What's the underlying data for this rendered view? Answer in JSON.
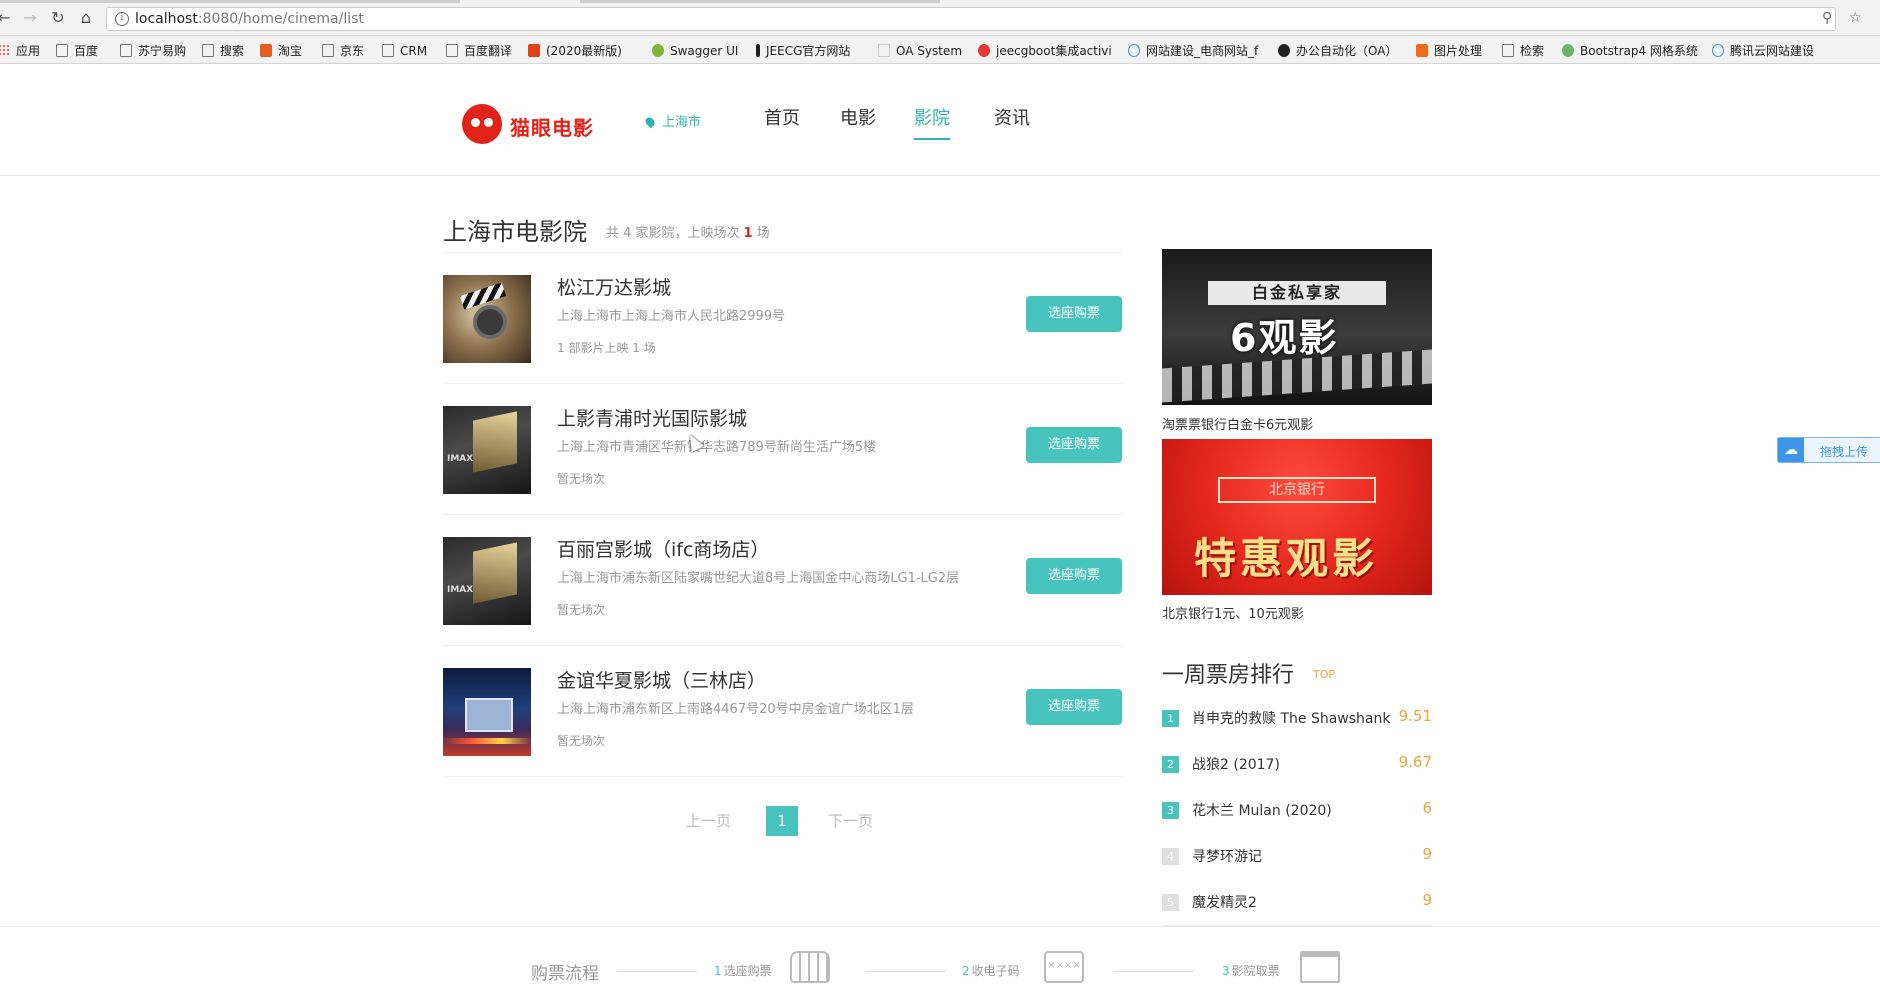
{
  "browser": {
    "url_host": "localhost",
    "url_path": ":8080/home/cinema/list",
    "bookmarks": [
      {
        "label": "应用",
        "icon": "apps-grid-icon"
      },
      {
        "label": "百度",
        "icon": "page-icon"
      },
      {
        "label": "苏宁易购",
        "icon": "page-icon"
      },
      {
        "label": "搜索",
        "icon": "page-icon"
      },
      {
        "label": "淘宝",
        "icon": "zhihu-icon"
      },
      {
        "label": "京东",
        "icon": "page-icon"
      },
      {
        "label": "CRM",
        "icon": "page-icon"
      },
      {
        "label": "百度翻译",
        "icon": "page-icon"
      },
      {
        "label": "(2020最新版)",
        "icon": "c-badge-icon"
      },
      {
        "label": "Swagger UI",
        "icon": "swagger-icon"
      },
      {
        "label": "JEECG官方网站",
        "icon": "jeecg-icon"
      },
      {
        "label": "OA System",
        "icon": "page-icon"
      },
      {
        "label": "jeecgboot集成activi",
        "icon": "g-icon"
      },
      {
        "label": "网站建设_电商网站_f",
        "icon": "cloud-icon"
      },
      {
        "label": "办公自动化（OA）",
        "icon": "github-icon"
      },
      {
        "label": "图片处理",
        "icon": "office-icon"
      },
      {
        "label": "检索",
        "icon": "search-bookmark-icon"
      },
      {
        "label": "Bootstrap4 网格系统",
        "icon": "bootstrap-icon"
      },
      {
        "label": "腾讯云网站建设",
        "icon": "cloud-icon"
      }
    ]
  },
  "header": {
    "logo_text": "猫眼电影",
    "city": "上海市",
    "nav": [
      {
        "label": "首页",
        "active": false
      },
      {
        "label": "电影",
        "active": false
      },
      {
        "label": "影院",
        "active": true
      },
      {
        "label": "资讯",
        "active": false
      }
    ]
  },
  "listing": {
    "title": "上海市电影院",
    "stats_prefix": "共 4 家影院，上映场次",
    "stats_count": "1",
    "stats_suffix": "场",
    "buy_label": "选座购票",
    "cinemas": [
      {
        "name": "松江万达影城",
        "address": "上海上海市上海上海市人民北路2999号",
        "shows": "1 部影片上映 1 场",
        "thumb": "clapper"
      },
      {
        "name": "上影青浦时光国际影城",
        "address": "上海上海市青浦区华新镇华志路789号新尚生活广场5楼",
        "shows": "暂无场次",
        "thumb": "hall"
      },
      {
        "name": "百丽宫影城（ifc商场店）",
        "address": "上海上海市浦东新区陆家嘴世纪大道8号上海国金中心商场LG1-LG2层",
        "shows": "暂无场次",
        "thumb": "hall"
      },
      {
        "name": "金谊华夏影城（三林店）",
        "address": "上海上海市浦东新区上南路4467号20号中房金谊广场北区1层",
        "shows": "暂无场次",
        "thumb": "night"
      }
    ]
  },
  "pagination": {
    "prev": "上一页",
    "current": "1",
    "next": "下一页"
  },
  "sidebar": {
    "promos": [
      {
        "caption": "淘票票银行白金卡6元观影",
        "ribbon": "白金私享家",
        "big": "6观影"
      },
      {
        "caption": "北京银行1元、10元观影",
        "ribbon": "北京银行",
        "big": "特惠观影"
      }
    ],
    "rank_title": "一周票房排行",
    "rank_tag": "TOP",
    "ranking": [
      {
        "rank": "1",
        "movie": "肖申克的救赎 The Shawshank...",
        "score": "9.51"
      },
      {
        "rank": "2",
        "movie": "战狼2 (2017)",
        "score": "9.67"
      },
      {
        "rank": "3",
        "movie": "花木兰 Mulan (2020)",
        "score": "6"
      },
      {
        "rank": "4",
        "movie": "寻梦环游记",
        "score": "9"
      },
      {
        "rank": "5",
        "movie": "魔发精灵2",
        "score": "9"
      }
    ]
  },
  "footer": {
    "flow_title": "购票流程",
    "steps": [
      {
        "n": "1",
        "label": "选座购票"
      },
      {
        "n": "2",
        "label": "收电子码"
      },
      {
        "n": "3",
        "label": "影院取票"
      }
    ],
    "code_icon_text": "××××"
  },
  "upload_float": {
    "label": "拖拽上传"
  },
  "colors": {
    "brand_red": "#e2231a",
    "accent_teal": "#47c4be",
    "score_orange": "#f0a33a"
  }
}
